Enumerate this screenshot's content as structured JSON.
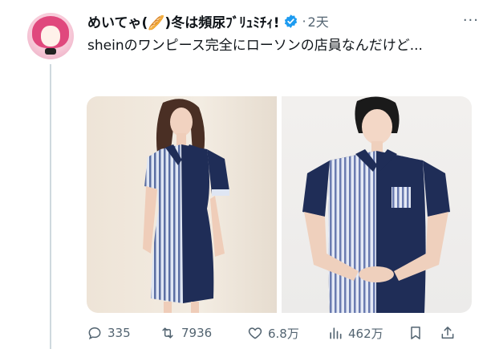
{
  "tweet": {
    "display_name": "めいてゃ(🥖)冬は頻尿ﾌﾞﾘｭﾐﾁｨ!",
    "separator": "·",
    "timestamp": "2天",
    "more": "···",
    "text": "sheinのワンピース完全にローソンの店員なんだけど...",
    "images": [
      "shein-striped-navy-dress",
      "lawson-staff-uniform"
    ]
  },
  "actions": {
    "reply_count": "335",
    "retweet_count": "7936",
    "like_count": "6.8万",
    "view_count": "462万"
  },
  "colors": {
    "text": "#0f1419",
    "secondary": "#536471",
    "verified": "#1d9bf0",
    "navy": "#1f2d57",
    "stripe": "#c9d4ea"
  }
}
